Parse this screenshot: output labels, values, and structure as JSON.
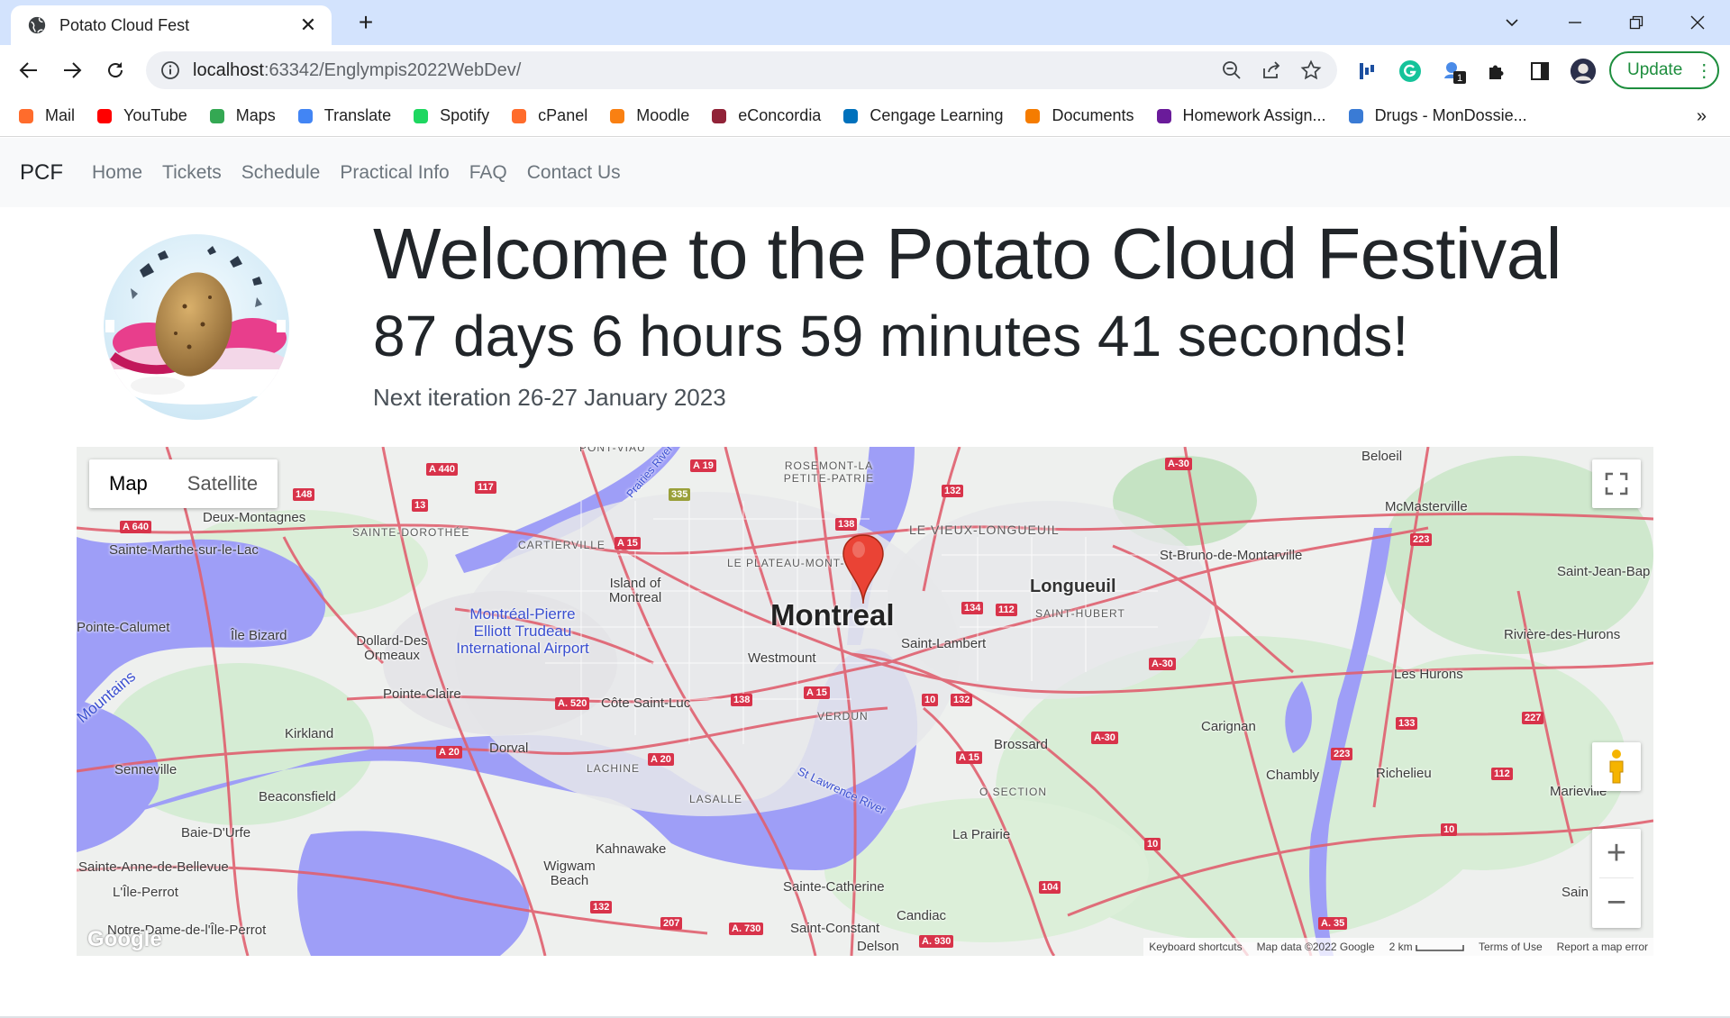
{
  "browser": {
    "tab_title": "Potato Cloud Fest",
    "url_host": "localhost",
    "url_rest": ":63342/Englympis2022WebDev/",
    "update_label": "Update",
    "extension_badge": "1"
  },
  "bookmarks": [
    {
      "label": "Mail",
      "icon": "cpanel-icon",
      "color": "#ff6c2c"
    },
    {
      "label": "YouTube",
      "icon": "youtube-icon",
      "color": "#ff0000"
    },
    {
      "label": "Maps",
      "icon": "maps-pin-icon",
      "color": "#34a853"
    },
    {
      "label": "Translate",
      "icon": "translate-icon",
      "color": "#4285f4"
    },
    {
      "label": "Spotify",
      "icon": "spotify-icon",
      "color": "#1ed760"
    },
    {
      "label": "cPanel",
      "icon": "cpanel-icon",
      "color": "#ff6c2c"
    },
    {
      "label": "Moodle",
      "icon": "moodle-icon",
      "color": "#f98012"
    },
    {
      "label": "eConcordia",
      "icon": "econcordia-icon",
      "color": "#912338"
    },
    {
      "label": "Cengage Learning",
      "icon": "cengage-icon",
      "color": "#0071bc"
    },
    {
      "label": "Documents",
      "icon": "documents-icon",
      "color": "#f57c00"
    },
    {
      "label": "Homework Assign...",
      "icon": "homework-icon",
      "color": "#6a1b9a"
    },
    {
      "label": "Drugs - MonDossie...",
      "icon": "drugs-icon",
      "color": "#3a7bd5"
    }
  ],
  "site": {
    "brand": "PCF",
    "nav": [
      "Home",
      "Tickets",
      "Schedule",
      "Practical Info",
      "FAQ",
      "Contact Us"
    ],
    "title": "Welcome to the Potato Cloud Festival",
    "countdown": "87 days 6 hours 59 minutes 41 seconds!",
    "next_iteration": "Next iteration 26-27 January 2023"
  },
  "map": {
    "type_map": "Map",
    "type_satellite": "Satellite",
    "center_label": "Montreal",
    "labels": {
      "longueuil": "Longueuil",
      "vieux_longueuil": "LE VIEUX-LONGUEUIL",
      "saint_hubert": "SAINT-HUBERT",
      "saint_lambert": "Saint-Lambert",
      "westmount": "Westmount",
      "verdun": "VERDUN",
      "plateau": "LE PLATEAU-MONT-",
      "rosemont": "ROSEMONT-LA PETITE-PATRIE",
      "airport": "Montréal-Pierre Elliott Trudeau International Airport",
      "dorval": "Dorval",
      "pointe_claire": "Pointe-Claire",
      "cote_saint_luc": "Côte Saint-Luc",
      "lachine": "LACHINE",
      "lasalle": "LASALLE",
      "kirkland": "Kirkland",
      "beaconsfield": "Beaconsfield",
      "senneville": "Senneville",
      "baie_durfe": "Baie-D'Urfe",
      "ste_anne": "Sainte-Anne-de-Bellevue",
      "ile_perrot": "L'Île-Perrot",
      "notre_dame": "Notre-Dame-de-l'Île-Perrot",
      "pointe_calumet": "Pointe-Calumet",
      "ile_bizard": "Île Bizard",
      "dollard": "Dollard-Des Ormeaux",
      "deux_montagnes": "Deux-Montagnes",
      "ste_marthe": "Sainte-Marthe-sur-le-Lac",
      "ste_dorothee": "SAINTE-DOROTHÉE",
      "cartierville": "CARTIERVILLE",
      "island": "Island of Montreal",
      "kahnawake": "Kahnawake",
      "wigwam": "Wigwam Beach",
      "ste_catherine": "Sainte-Catherine",
      "candiac": "Candiac",
      "st_constant": "Saint-Constant",
      "delson": "Delson",
      "la_prairie": "La Prairie",
      "brossard": "Brossard",
      "carignan": "Carignan",
      "chambly": "Chambly",
      "richelieu": "Richelieu",
      "marieville": "Marieville",
      "les_hurons": "Les Hurons",
      "riviere_hurons": "Rivière-des-Hurons",
      "st_bruno": "St-Bruno-de-Montarville",
      "mcmasterville": "McMasterville",
      "beloeil": "Beloeil",
      "st_jean": "Saint-Jean-Bap",
      "st_lawrence": "St Lawrence River",
      "section": "O SECTION",
      "prairies": "Prairies River",
      "mountains": "Mountains",
      "pont_viau": "PONT-VIAU",
      "sain": "Sain"
    },
    "attribution": {
      "shortcuts": "Keyboard shortcuts",
      "data": "Map data ©2022 Google",
      "scale": "2 km",
      "terms": "Terms of Use",
      "report": "Report a map error"
    },
    "google_logo": "Google"
  }
}
